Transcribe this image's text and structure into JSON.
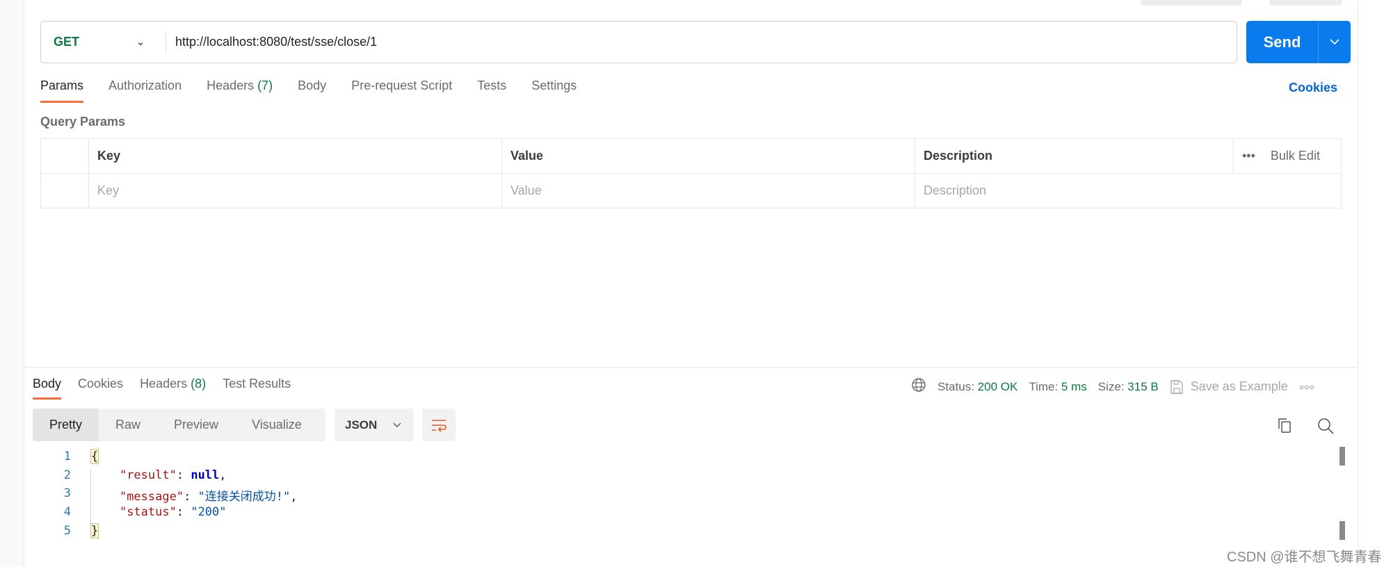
{
  "request": {
    "method": "GET",
    "url": "http://localhost:8080/test/sse/close/1",
    "send_label": "Send"
  },
  "request_tabs": [
    {
      "label": "Params",
      "active": true
    },
    {
      "label": "Authorization"
    },
    {
      "label": "Headers",
      "count": "(7)"
    },
    {
      "label": "Body"
    },
    {
      "label": "Pre-request Script"
    },
    {
      "label": "Tests"
    },
    {
      "label": "Settings"
    }
  ],
  "cookies_link": "Cookies",
  "query_params": {
    "title": "Query Params",
    "headers": [
      "Key",
      "Value",
      "Description"
    ],
    "bulk_edit": "Bulk Edit",
    "placeholders": [
      "Key",
      "Value",
      "Description"
    ]
  },
  "response_tabs": [
    {
      "label": "Body",
      "active": true
    },
    {
      "label": "Cookies"
    },
    {
      "label": "Headers",
      "count": "(8)"
    },
    {
      "label": "Test Results"
    }
  ],
  "status": {
    "status_label": "Status:",
    "status_value": "200 OK",
    "time_label": "Time:",
    "time_value": "5 ms",
    "size_label": "Size:",
    "size_value": "315 B",
    "save_example": "Save as Example"
  },
  "view_modes": [
    "Pretty",
    "Raw",
    "Preview",
    "Visualize"
  ],
  "format": "JSON",
  "code": {
    "line_numbers": [
      "1",
      "2",
      "3",
      "4",
      "5"
    ],
    "open": "{",
    "close": "}",
    "k1": "\"result\"",
    "v1": "null",
    "k2": "\"message\"",
    "v2": "\"连接关闭成功!\"",
    "k3": "\"status\"",
    "v3": "\"200\""
  },
  "watermark": "CSDN @谁不想飞舞青春",
  "colors": {
    "accent": "#ff6c37",
    "send": "#097bed",
    "success": "#0b7a3e",
    "link": "#0265d2"
  }
}
